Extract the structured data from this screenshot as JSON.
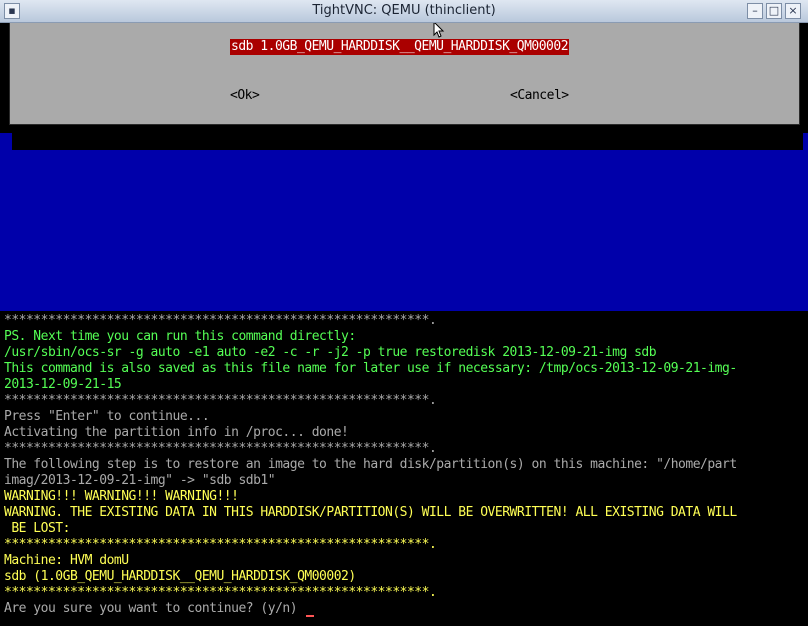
{
  "window": {
    "title": "TightVNC: QEMU (thinclient)",
    "buttons": {
      "minimize": "–",
      "maximize": "□",
      "close": "×"
    }
  },
  "dialog": {
    "selected_item": "sdb 1.0GB_QEMU_HARDDISK__QEMU_HARDDISK_QM00002",
    "ok_label": "<Ok>",
    "cancel_label": "<Cancel>"
  },
  "terminal": {
    "lines": [
      "**********************************************************.",
      "PS. Next time you can run this command directly:",
      "/usr/sbin/ocs-sr -g auto -e1 auto -e2 -c -r -j2 -p true restoredisk 2013-12-09-21-img sdb",
      "This command is also saved as this file name for later use if necessary: /tmp/ocs-2013-12-09-21-img-",
      "2013-12-09-21-15",
      "**********************************************************.",
      "Press \"Enter\" to continue...",
      "Activating the partition info in /proc... done!",
      "**********************************************************.",
      "The following step is to restore an image to the hard disk/partition(s) on this machine: \"/home/part",
      "imag/2013-12-09-21-img\" -> \"sdb sdb1\"",
      "WARNING!!! WARNING!!! WARNING!!!",
      "WARNING. THE EXISTING DATA IN THIS HARDDISK/PARTITION(S) WILL BE OVERWRITTEN! ALL EXISTING DATA WILL",
      " BE LOST:",
      "**********************************************************.",
      "Machine: HVM domU",
      "sdb (1.0GB_QEMU_HARDDISK__QEMU_HARDDISK_QM00002)",
      "**********************************************************.",
      "Are you sure you want to continue? (y/n) "
    ],
    "line_colors": [
      "#aaaaaa",
      "#55ff55",
      "#55ff55",
      "#55ff55",
      "#55ff55",
      "#aaaaaa",
      "#aaaaaa",
      "#aaaaaa",
      "#aaaaaa",
      "#aaaaaa",
      "#aaaaaa",
      "#ffff55",
      "#ffff55",
      "#ffff55",
      "#ffff55",
      "#ffff55",
      "#ffff55",
      "#ffff55",
      "#aaaaaa"
    ]
  },
  "colors": {
    "dialog_bg": "#aaaaaa",
    "selection": "#aa0000",
    "blue_band": "#0000aa",
    "yellow": "#ffff55",
    "green": "#55ff55"
  },
  "icons": {
    "window_menu": "window-menu-icon",
    "mouse_pointer": "mouse-pointer-icon"
  }
}
